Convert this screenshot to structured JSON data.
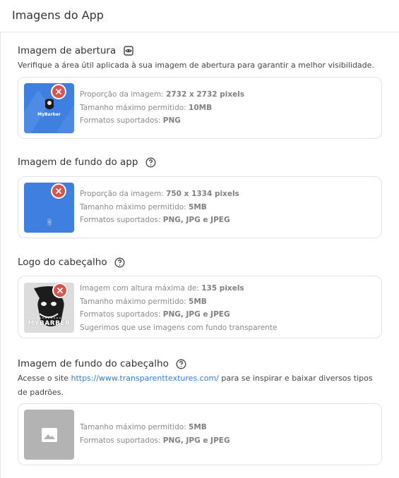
{
  "header": {
    "title": "Imagens do App"
  },
  "sections": {
    "splash": {
      "title": "Imagem de abertura",
      "description": "Verifique a área útil aplicada à sua imagem de abertura para garantir a melhor visibilidade.",
      "thumb_caption": "MyBarber",
      "lines": [
        {
          "label": "Proporção da imagem: ",
          "value": "2732 x 2732 pixels"
        },
        {
          "label": "Tamanho máximo permitido: ",
          "value": "10MB"
        },
        {
          "label": "Formatos suportados: ",
          "value": "PNG"
        }
      ]
    },
    "app_background": {
      "title": "Imagem de fundo do app",
      "lines": [
        {
          "label": "Proporção da imagem: ",
          "value": "750 x 1334 pixels"
        },
        {
          "label": "Tamanho máximo permitido: ",
          "value": "5MB"
        },
        {
          "label": "Formatos suportados: ",
          "value": "PNG, JPG e JPEG"
        }
      ]
    },
    "header_logo": {
      "title": "Logo do cabeçalho",
      "thumb_caption": "MYBARBER",
      "lines": [
        {
          "label": "Imagem com altura máxima de: ",
          "value": "135 pixels"
        },
        {
          "label": "Tamanho máximo permitido: ",
          "value": "5MB"
        },
        {
          "label": "Formatos suportados: ",
          "value": "PNG, JPG e JPEG"
        },
        {
          "label": "Sugerimos que use imagens com fundo transparente",
          "value": ""
        }
      ]
    },
    "header_background": {
      "title": "Imagem de fundo do cabeçalho",
      "desc_prefix": "Acesse o site ",
      "link_text": "https://www.transparenttextures.com/",
      "desc_suffix": " para se inspirar e baixar diversos tipos de padrões.",
      "lines": [
        {
          "label": "Tamanho máximo permitido: ",
          "value": "5MB"
        },
        {
          "label": "Formatos suportados: ",
          "value": "PNG, JPG e JPEG"
        }
      ]
    }
  },
  "colors": {
    "accent_blue": "#3f7fe0",
    "remove_red": "#d9534f",
    "link": "#2f7ed8",
    "placeholder_gray": "#b3b3b3"
  },
  "icons": {
    "preview": "eye-icon",
    "help": "help-circle-icon",
    "remove": "close-icon",
    "placeholder": "image-icon"
  }
}
